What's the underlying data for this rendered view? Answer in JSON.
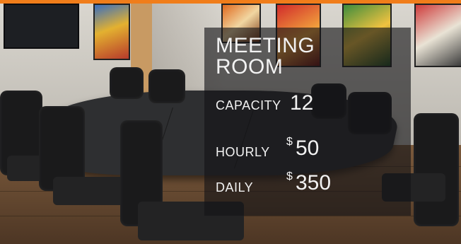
{
  "title": {
    "line1": "MEETING",
    "line2": "ROOM"
  },
  "rates": {
    "capacity": {
      "label": "CAPACITY",
      "value": "12"
    },
    "hourly": {
      "label": "HOURLY",
      "currency": "$",
      "value": "50"
    },
    "daily": {
      "label": "DAILY",
      "currency": "$",
      "value": "350"
    }
  },
  "colors": {
    "accent_bar": "#f07d1a",
    "overlay": "#141416",
    "text": "#f2f2f2"
  }
}
